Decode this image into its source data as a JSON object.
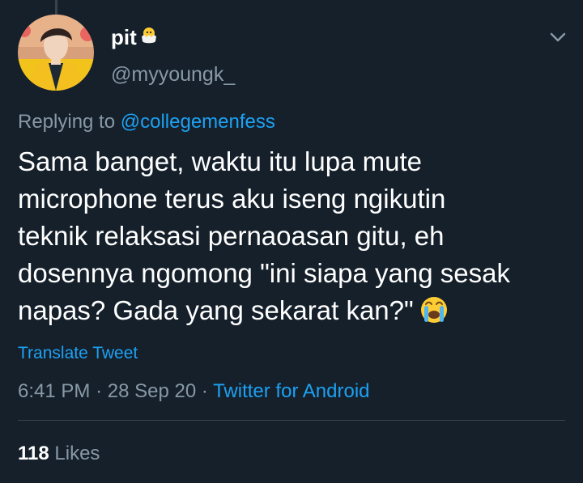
{
  "author": {
    "display_name": "pit",
    "display_name_emoji": "hatching-chick-icon",
    "handle": "@myyoungk_"
  },
  "reply": {
    "prefix": "Replying to",
    "mention": "@collegemenfess"
  },
  "tweet": {
    "lines": [
      "Sama banget, waktu itu lupa mute",
      "microphone terus aku iseng ngikutin",
      "teknik relaksasi pernaoasan gitu, eh",
      "dosennya ngomong \"ini siapa yang sesak",
      "napas? Gada yang sekarat kan?\""
    ],
    "trailing_emoji": "loudly-crying-face-icon"
  },
  "translate_label": "Translate Tweet",
  "meta": {
    "time": "6:41 PM",
    "date": "28 Sep 20",
    "separator": "·",
    "source": "Twitter for Android"
  },
  "stats": {
    "likes_count": "118",
    "likes_label": "Likes"
  },
  "colors": {
    "background": "#15202b",
    "secondary_text": "#8899a6",
    "link": "#1da1f2",
    "divider": "#38444d"
  }
}
